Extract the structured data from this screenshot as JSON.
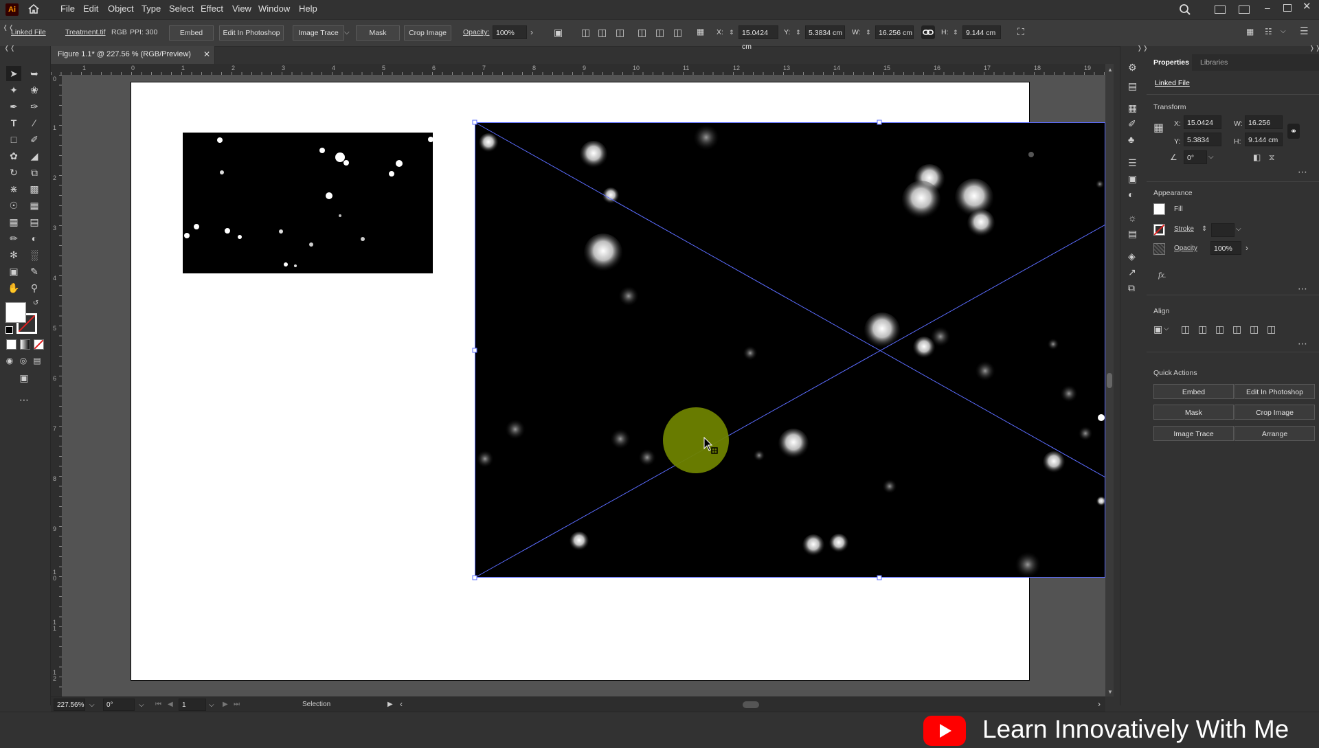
{
  "app": {
    "logo": "Ai"
  },
  "menu": [
    "File",
    "Edit",
    "Object",
    "Type",
    "Select",
    "Effect",
    "View",
    "Window",
    "Help"
  ],
  "control_bar": {
    "linked_file": "Linked File",
    "file_name": "Treatment.tif",
    "color_mode": "RGB",
    "ppi": "PPI: 300",
    "embed": "Embed",
    "edit_in_photoshop": "Edit In Photoshop",
    "image_trace": "Image Trace",
    "mask": "Mask",
    "crop_image": "Crop Image",
    "opacity_label": "Opacity:",
    "opacity_value": "100%",
    "x_label": "X:",
    "x_value": "15.0424 cm",
    "y_label": "Y:",
    "y_value": "5.3834 cm",
    "w_label": "W:",
    "w_value": "16.256 cm",
    "h_label": "H:",
    "h_value": "9.144 cm"
  },
  "document": {
    "tab_title": "Figure 1.1* @ 227.56 % (RGB/Preview)"
  },
  "rulers": {
    "h_ticks": [
      "1",
      "0",
      "1",
      "2",
      "3",
      "4",
      "5",
      "6",
      "7",
      "8",
      "9",
      "10",
      "11",
      "12",
      "13",
      "14",
      "15",
      "16",
      "17",
      "18",
      "19"
    ],
    "v_ticks": [
      "0",
      "1",
      "2",
      "3",
      "4",
      "5",
      "6",
      "7",
      "8",
      "9",
      "1\n0",
      "1\n1",
      "1\n2"
    ]
  },
  "properties": {
    "tabs": [
      "Properties",
      "Libraries"
    ],
    "object_type": "Linked File",
    "transform": {
      "heading": "Transform",
      "x_label": "X:",
      "x": "15.0424 cm",
      "y_label": "Y:",
      "y": "5.3834 cm",
      "w_label": "W:",
      "w": "16.256 cm",
      "h_label": "H:",
      "h": "9.144 cm",
      "angle": "0°"
    },
    "appearance": {
      "heading": "Appearance",
      "fill": "Fill",
      "stroke": "Stroke",
      "opacity_label": "Opacity",
      "opacity_value": "100%",
      "fx": "fx."
    },
    "align": {
      "heading": "Align"
    },
    "quick_actions": {
      "heading": "Quick Actions",
      "buttons": [
        "Embed",
        "Edit In Photoshop",
        "Mask",
        "Crop Image",
        "Image Trace",
        "Arrange"
      ]
    }
  },
  "status": {
    "zoom": "227.56%",
    "rotation": "0°",
    "artboard": "1",
    "mode": "Selection"
  },
  "watermark": {
    "text": "Learn Innovatively With Me"
  },
  "colors": {
    "bounding_box": "#5b6cff",
    "cursor_highlight": "#7a8c00",
    "youtube_red": "#ff0000"
  },
  "icons": {
    "home": "home-icon",
    "search": "search-icon",
    "link": "link-icon",
    "workspace": "workspace-icon",
    "minimize": "minimize-icon",
    "maximize": "maximize-icon",
    "close": "close-icon"
  }
}
